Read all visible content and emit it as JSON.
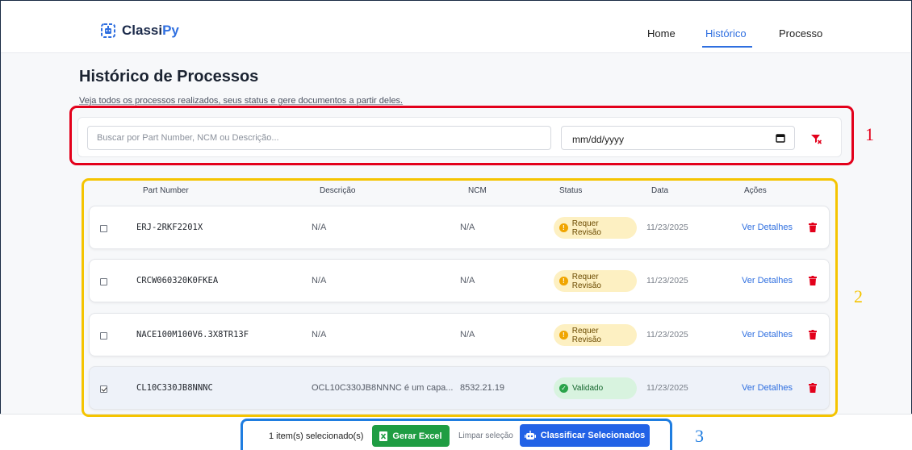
{
  "brand": {
    "name_main": "Classi",
    "name_accent": "Py"
  },
  "nav": {
    "home": "Home",
    "history": "Histórico",
    "process": "Processo",
    "active": "Histórico"
  },
  "page": {
    "title": "Histórico de Processos",
    "subtitle": "Veja todos os processos realizados, seus status e gere documentos a partir deles."
  },
  "filters": {
    "search_placeholder": "Buscar por Part Number, NCM ou Descrição...",
    "date_value": "mm/dd/yyyy"
  },
  "table": {
    "headers": {
      "part": "Part Number",
      "desc": "Descrição",
      "ncm": "NCM",
      "status": "Status",
      "date": "Data",
      "actions": "Ações"
    },
    "rows": [
      {
        "part": "ERJ-2RKF2201X",
        "desc": "N/A",
        "ncm": "N/A",
        "status": "Requer Revisão",
        "date": "11/23/2025",
        "action": "Ver Detalhes",
        "checked": false
      },
      {
        "part": "CRCW060320K0FKEA",
        "desc": "N/A",
        "ncm": "N/A",
        "status": "Requer Revisão",
        "date": "11/23/2025",
        "action": "Ver Detalhes",
        "checked": false
      },
      {
        "part": "NACE100M100V6.3X8TR13F",
        "desc": "N/A",
        "ncm": "N/A",
        "status": "Requer Revisão",
        "date": "11/23/2025",
        "action": "Ver Detalhes",
        "checked": false
      },
      {
        "part": "CL10C330JB8NNNC",
        "desc": "OCL10C330JB8NNNC é um capa...",
        "ncm": "8532.21.19",
        "status": "Validado",
        "date": "11/23/2025",
        "action": "Ver Detalhes",
        "checked": true
      }
    ]
  },
  "selection": {
    "count_text": "1 item(s) selecionado(s)",
    "excel": "Gerar Excel",
    "clear": "Limpar seleção",
    "classify": "Classificar Selecionados"
  },
  "annotations": {
    "n1": "1",
    "n2": "2",
    "n3": "3"
  },
  "colors": {
    "primary": "#2f6fe0",
    "excel_green": "#1f9d43",
    "classify_blue": "#2262e6",
    "review_badge": "#fdf0c2",
    "valid_badge": "#d8f3df",
    "delete_red": "#e3001b",
    "annot_red": "#e3001b",
    "annot_yellow": "#f5c400",
    "annot_blue": "#1f7de0"
  }
}
